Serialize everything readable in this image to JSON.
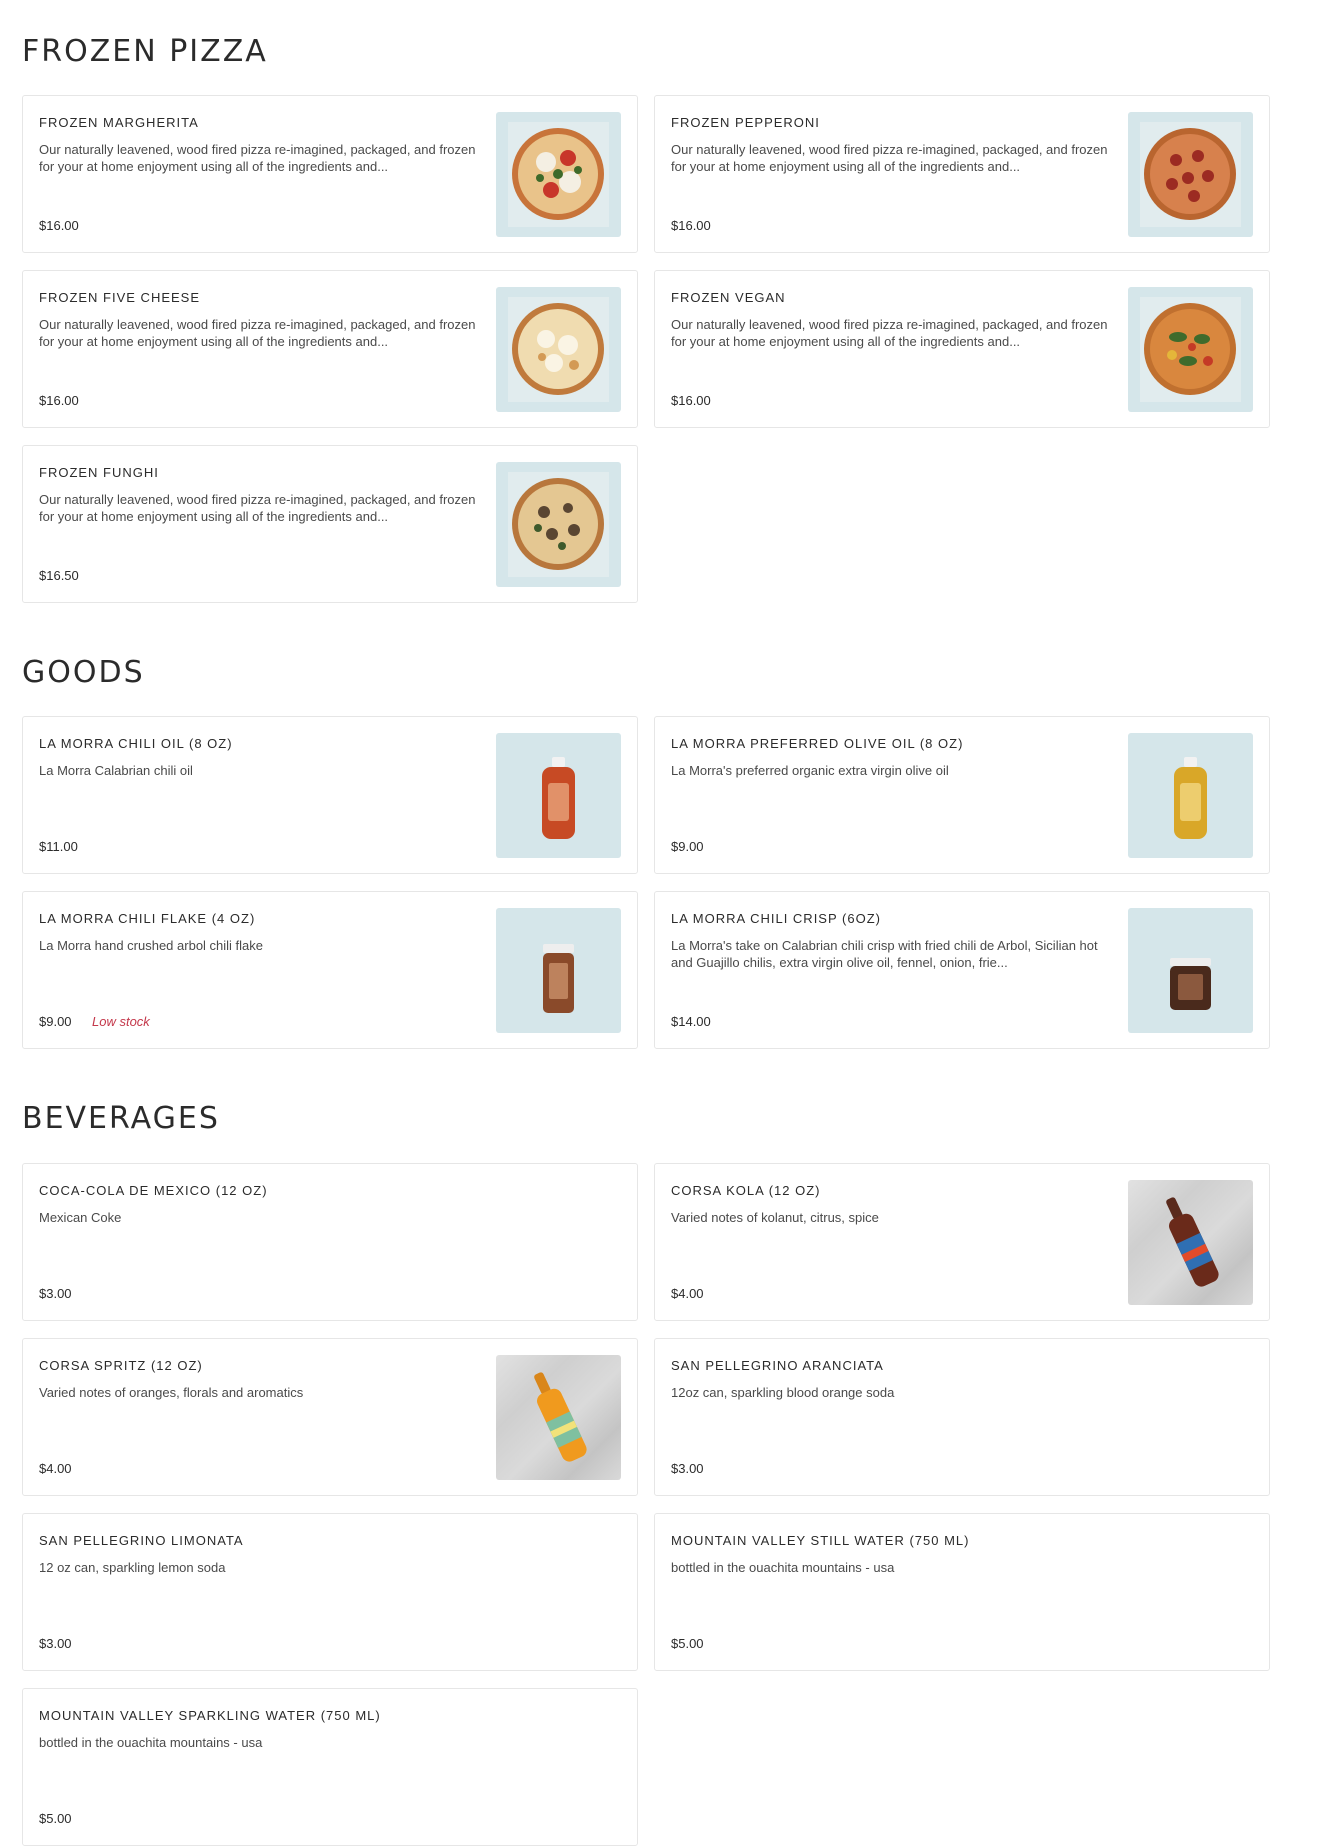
{
  "sections": [
    {
      "title": "FROZEN PIZZA",
      "items": [
        {
          "name": "FROZEN MARGHERITA",
          "description": "Our naturally leavened, wood fired pizza re-imagined, packaged, and frozen for your at home enjoyment using all of the ingredients and...",
          "price": "$16.00"
        },
        {
          "name": "FROZEN PEPPERONI",
          "description": "Our naturally leavened, wood fired pizza re-imagined, packaged, and frozen for your at home enjoyment using all of the ingredients and...",
          "price": "$16.00"
        },
        {
          "name": "FROZEN FIVE CHEESE",
          "description": "Our naturally leavened, wood fired pizza re-imagined, packaged, and frozen for your at home enjoyment using all of the ingredients and...",
          "price": "$16.00"
        },
        {
          "name": "FROZEN VEGAN",
          "description": "Our naturally leavened, wood fired pizza re-imagined, packaged, and frozen for your at home enjoyment using all of the ingredients and...",
          "price": "$16.00"
        },
        {
          "name": "FROZEN FUNGHI",
          "description": "Our naturally leavened, wood fired pizza re-imagined, packaged, and frozen for your at home enjoyment using all of the ingredients and...",
          "price": "$16.50"
        }
      ]
    },
    {
      "title": "GOODS",
      "items": [
        {
          "name": "LA MORRA CHILI OIL (8 OZ)",
          "description": "La Morra Calabrian chili oil",
          "price": "$11.00"
        },
        {
          "name": "LA MORRA PREFERRED OLIVE OIL (8 OZ)",
          "description": "La Morra's preferred organic extra virgin olive oil",
          "price": "$9.00"
        },
        {
          "name": "LA MORRA CHILI FLAKE (4 OZ)",
          "description": "La Morra hand crushed arbol chili flake",
          "price": "$9.00",
          "stock_label": "Low stock"
        },
        {
          "name": "LA MORRA CHILI CRISP (6OZ)",
          "description": "La Morra's take on Calabrian chili crisp with fried chili de Arbol, Sicilian hot and Guajillo chilis, extra virgin olive oil, fennel, onion, frie...",
          "price": "$14.00"
        }
      ]
    },
    {
      "title": "BEVERAGES",
      "items": [
        {
          "name": "COCA-COLA DE MEXICO (12 OZ)",
          "description": "Mexican Coke",
          "price": "$3.00"
        },
        {
          "name": "CORSA KOLA (12 OZ)",
          "description": "Varied notes of kolanut, citrus, spice",
          "price": "$4.00"
        },
        {
          "name": "CORSA SPRITZ (12 OZ)",
          "description": "Varied notes of oranges, florals and aromatics",
          "price": "$4.00"
        },
        {
          "name": "SAN PELLEGRINO ARANCIATA",
          "description": "12oz can, sparkling blood orange soda",
          "price": "$3.00"
        },
        {
          "name": "SAN PELLEGRINO LIMONATA",
          "description": "12 oz can, sparkling lemon soda",
          "price": "$3.00"
        },
        {
          "name": "MOUNTAIN VALLEY STILL WATER (750 ML)",
          "description": "bottled in the ouachita mountains - usa",
          "price": "$5.00"
        },
        {
          "name": "MOUNTAIN VALLEY SPARKLING WATER (750 ML)",
          "description": "bottled in the ouachita mountains - usa",
          "price": "$5.00"
        }
      ]
    }
  ],
  "colors": {
    "thumb_background": "#d5e6ea",
    "low_stock": "#c4384b",
    "card_border": "#e6e6e6"
  }
}
